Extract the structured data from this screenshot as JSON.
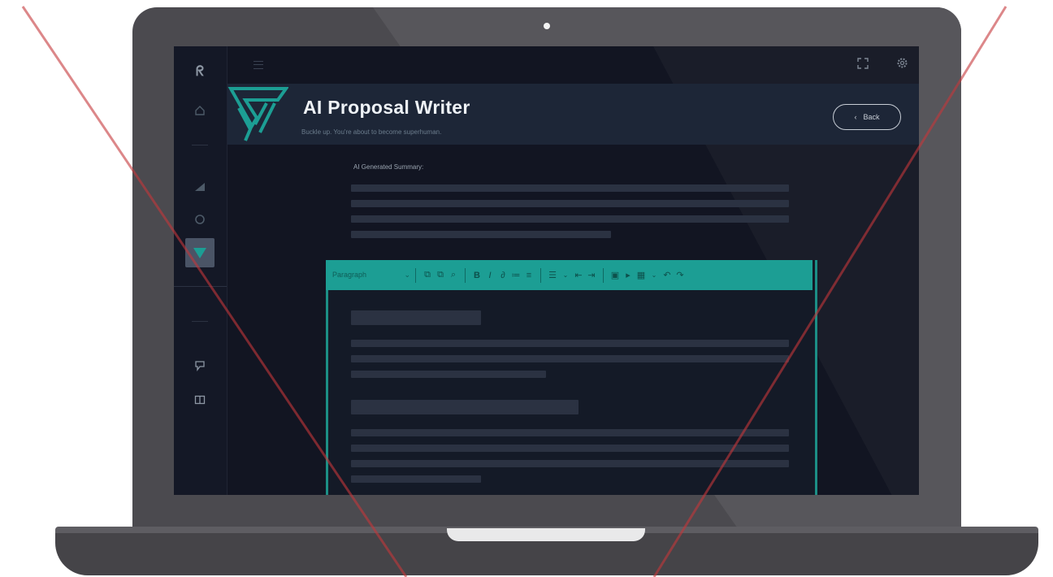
{
  "app": {
    "title": "AI Proposal Writer",
    "subtitle": "Buckle up. You're about to become superhuman."
  },
  "topbar": {
    "menu_icon": "hamburger-icon",
    "fullscreen_icon": "expand-icon",
    "settings_icon": "gear-icon"
  },
  "sidebar": {
    "logo_icon": "brand-logo-icon",
    "items": [
      {
        "icon": "home-icon",
        "glyph": "⌂"
      },
      {
        "icon": "chart-icon",
        "glyph": "◢"
      },
      {
        "icon": "circle-icon",
        "glyph": "○"
      },
      {
        "icon": "proposal-writer-icon",
        "glyph": "▼",
        "active": true
      },
      {
        "icon": "chat-icon",
        "glyph": "ⵖ"
      },
      {
        "icon": "book-icon",
        "glyph": "◫"
      }
    ]
  },
  "header": {
    "back_label": "Back",
    "back_icon": "chevron-left-icon"
  },
  "summary": {
    "label": "AI Generated Summary:"
  },
  "editor": {
    "paragraph_select": "Paragraph",
    "toolbar_icons": [
      "copy-icon",
      "paste-icon",
      "search-icon",
      "bold-icon",
      "italic-icon",
      "link-icon",
      "bullet-list-icon",
      "numbered-list-icon",
      "align-icon",
      "outdent-icon",
      "indent-icon",
      "image-icon",
      "media-icon",
      "table-icon",
      "undo-icon",
      "redo-icon"
    ]
  },
  "colors": {
    "accent": "#1c9e94",
    "background": "#121522",
    "hero_background": "#1d2637",
    "cross_line": "#c4373b"
  }
}
